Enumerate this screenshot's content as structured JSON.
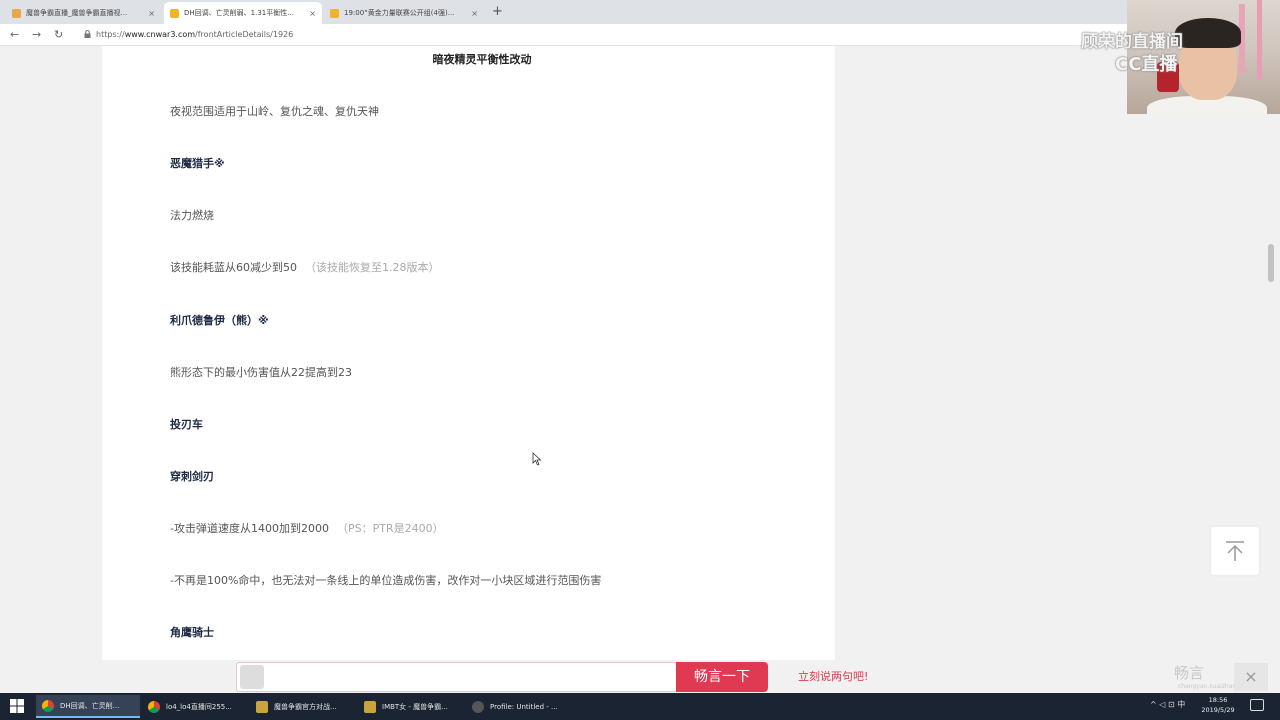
{
  "browser": {
    "tabs": [
      {
        "title": "魔兽争霸直播_魔兽争霸直播视...",
        "active": false,
        "favicon_color": "#e8a84a"
      },
      {
        "title": "DH回调、亡灵削弱、1.31平衡性...",
        "active": true,
        "favicon_color": "#f0b429"
      },
      {
        "title": "19:00”黄金力量联赛公开组(4强)...",
        "active": false,
        "favicon_color": "#f0b429"
      }
    ],
    "url_prefix": "https://",
    "url_host": "www.cnwar3.com",
    "url_path": "/frontArticleDetails/1926",
    "new_tab": "+",
    "back": "←",
    "forward": "→",
    "reload": "↻",
    "close_tab": "×"
  },
  "article": {
    "section_title": "暗夜精灵平衡性改动",
    "lines": [
      {
        "text": "夜视范围适用于山岭、复仇之魂、复仇天神",
        "type": "text",
        "note": ""
      },
      {
        "text": "恶魔猎手※",
        "type": "heading",
        "note": ""
      },
      {
        "text": "法力燃烧",
        "type": "text",
        "note": ""
      },
      {
        "text": "该技能耗蓝从60减少到50",
        "type": "text",
        "note": "（该技能恢复至1.28版本）"
      },
      {
        "text": "利爪德鲁伊（熊）※",
        "type": "heading",
        "note": ""
      },
      {
        "text": "熊形态下的最小伤害值从22提高到23",
        "type": "text",
        "note": ""
      },
      {
        "text": "投刃车",
        "type": "heading",
        "note": ""
      },
      {
        "text": "穿刺剑刃",
        "type": "heading",
        "note": ""
      },
      {
        "text": "-攻击弹道速度从1400加到2000",
        "type": "text",
        "note": "（PS：PTR是2400）"
      },
      {
        "text": "-不再是100%命中，也无法对一条线上的单位造成伤害，改作对一小块区域进行范围伤害",
        "type": "text",
        "note": ""
      },
      {
        "text": "角鹰骑士",
        "type": "heading",
        "note": ""
      }
    ]
  },
  "watermark": {
    "line1": "顾荣的直播间",
    "line2": "CC直播"
  },
  "comment_bar": {
    "button_label": "畅言一下",
    "prompt": "立刻说两句吧!",
    "logo": "畅言",
    "logo_sub": "changyan.kuaizhan.com",
    "close": "×"
  },
  "taskbar": {
    "items": [
      {
        "label": "DH回调、亡灵削...",
        "active": true,
        "icon_color": "#f3b21b"
      },
      {
        "label": "lo4_lo4直播间255...",
        "active": false,
        "icon_color": "#e0403a"
      },
      {
        "label": "魔兽争霸官方对战...",
        "active": false,
        "icon_color": "#d9b34a"
      },
      {
        "label": "IMBT女 - 魔兽争霸...",
        "active": false,
        "icon_color": "#d9b34a"
      },
      {
        "label": "Profile: Untitled - ...",
        "active": false,
        "icon_color": "#8a8a8a"
      }
    ],
    "time": "18:56",
    "date": "2019/5/29",
    "tray": "^ ◁ ⊡ 中"
  },
  "colors": {
    "accent": "#e03a52",
    "heading": "#1f2a44",
    "note": "#aaaaaa",
    "taskbar": "#1a2433"
  }
}
